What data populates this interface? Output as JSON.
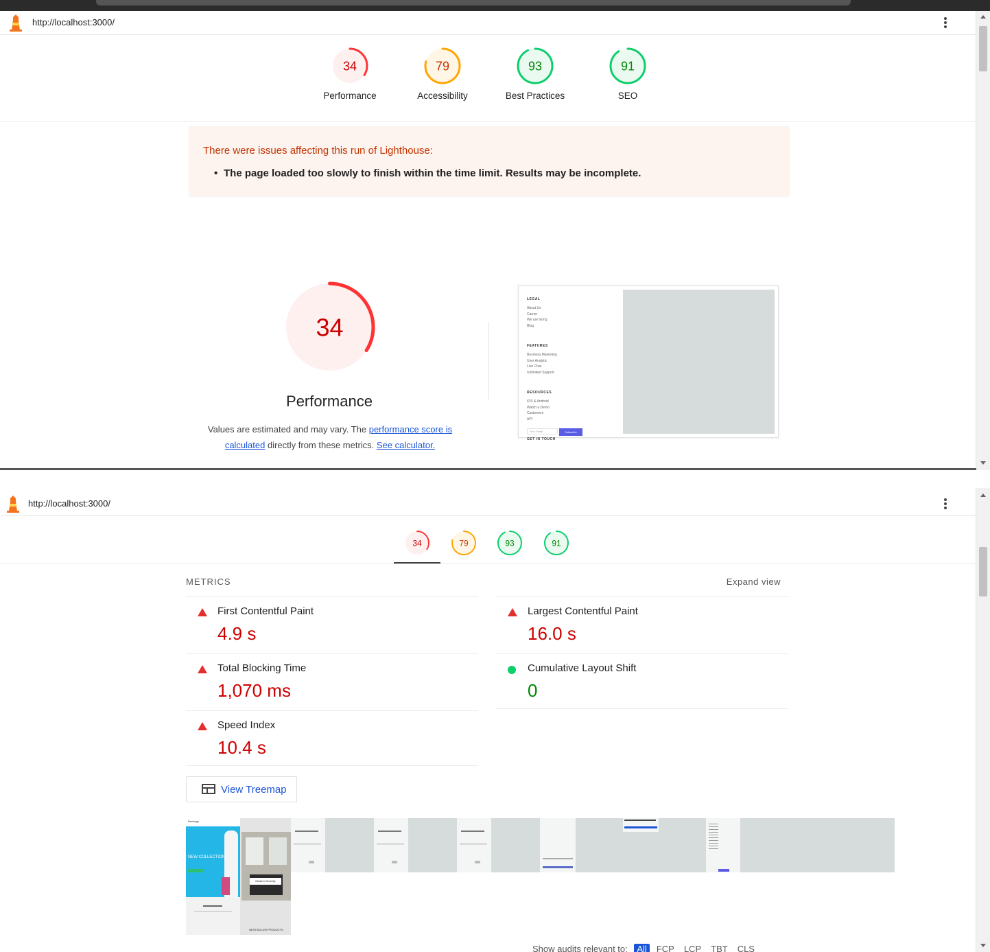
{
  "url": "http://localhost:3000/",
  "colors": {
    "fail": "#ff3333",
    "average": "#ffa400",
    "pass": "#0cce6b",
    "link": "#1a55d8"
  },
  "categories": [
    {
      "label": "Performance",
      "score": 34,
      "rating": "fail"
    },
    {
      "label": "Accessibility",
      "score": 79,
      "rating": "average"
    },
    {
      "label": "Best Practices",
      "score": 93,
      "rating": "pass"
    },
    {
      "label": "SEO",
      "score": 91,
      "rating": "pass"
    }
  ],
  "warnings": {
    "title": "There were issues affecting this run of Lighthouse:",
    "items": [
      "The page loaded too slowly to finish within the time limit. Results may be incomplete."
    ]
  },
  "performance": {
    "score": 34,
    "title": "Performance",
    "desc_pre": "Values are estimated and may vary. The ",
    "desc_link1": "performance score is calculated",
    "desc_mid": " directly from these metrics. ",
    "desc_link2": "See calculator."
  },
  "final_screenshot": {
    "sections": [
      {
        "heading": "LEGAL",
        "links": [
          "About Us",
          "Carrier",
          "We are hiring",
          "Blog"
        ]
      },
      {
        "heading": "FEATURES",
        "links": [
          "Business Marketing",
          "User Analytic",
          "Live Chat",
          "Unlimited Support"
        ]
      },
      {
        "heading": "RESOURCES",
        "links": [
          "IOS & Android",
          "Watch a Demo",
          "Customers",
          "API"
        ]
      },
      {
        "heading": "GET IN TOUCH",
        "links": []
      }
    ],
    "email_placeholder": "Your Email",
    "subscribe": "Subscribe"
  },
  "metrics": {
    "heading": "METRICS",
    "expand": "Expand view",
    "items": [
      {
        "name": "First Contentful Paint",
        "value": "4.9 s",
        "rating": "fail"
      },
      {
        "name": "Largest Contentful Paint",
        "value": "16.0 s",
        "rating": "fail"
      },
      {
        "name": "Total Blocking Time",
        "value": "1,070 ms",
        "rating": "fail"
      },
      {
        "name": "Cumulative Layout Shift",
        "value": "0",
        "rating": "pass"
      },
      {
        "name": "Speed Index",
        "value": "10.4 s",
        "rating": "fail"
      }
    ]
  },
  "treemap": {
    "label": "View Treemap"
  },
  "filmstrip": {
    "brand": "Bandage",
    "hero": "NEW COLLECTION",
    "card": "Modern Serenity",
    "bestseller": "BESTSELLER PRODUCTS"
  },
  "audits_filter": {
    "label": "Show audits relevant to:",
    "chips": [
      "All",
      "FCP",
      "LCP",
      "TBT",
      "CLS"
    ]
  }
}
